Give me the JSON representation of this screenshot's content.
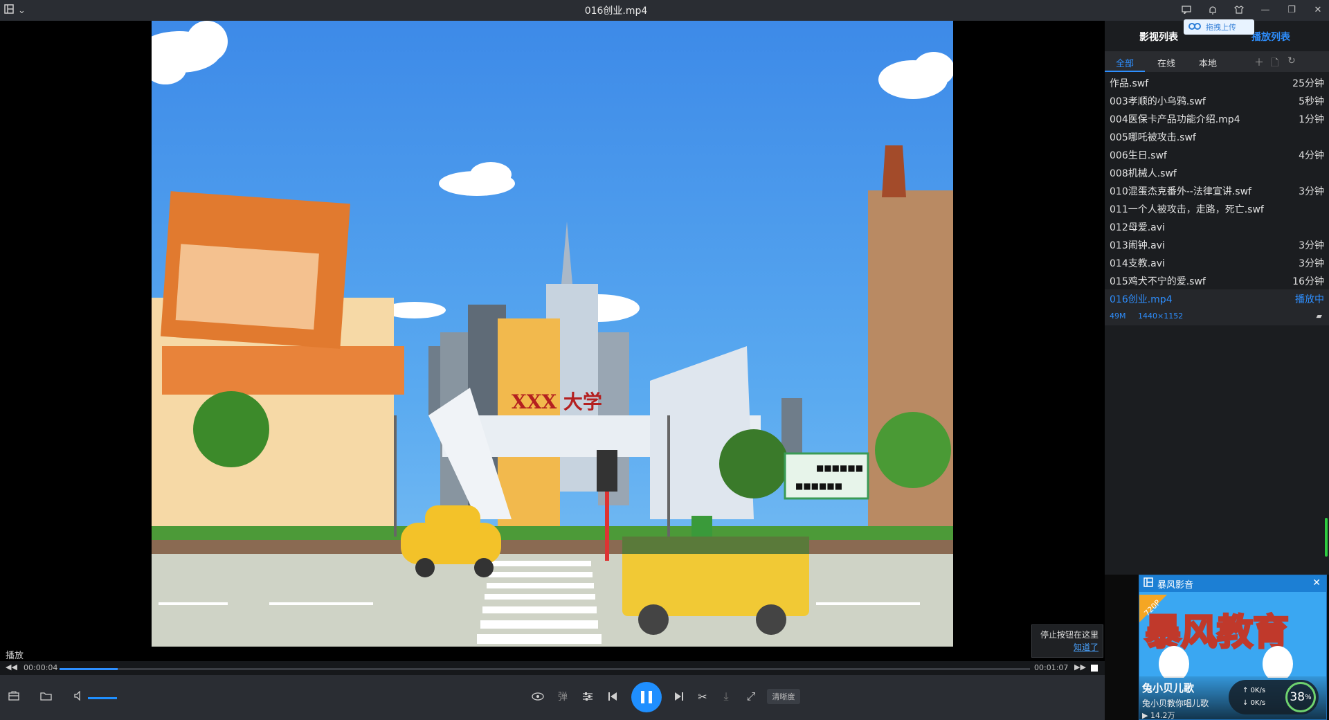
{
  "window": {
    "title": "016创业.mp4",
    "upload_tip": "拖拽上传"
  },
  "scene": {
    "gate_sign": "XXX 大学",
    "arrow_sign_top": "■■■■■■",
    "arrow_sign_bottom": "■■■■■■"
  },
  "player": {
    "status": "播放",
    "current_time": "00:00:04",
    "total_time": "00:01:07",
    "progress_fraction": 0.06,
    "volume_fraction": 0.7,
    "quality_label": "清晰度",
    "danmaku_label": "弹",
    "stop_tip": {
      "text": "停止按钮在这里",
      "ok": "知道了"
    }
  },
  "sidebar": {
    "tabs": [
      "影视列表",
      "播放列表"
    ],
    "filters": [
      "全部",
      "在线",
      "本地"
    ],
    "items": [
      {
        "name": "作品.swf",
        "duration": "25分钟"
      },
      {
        "name": "003孝顺的小乌鸦.swf",
        "duration": "5秒钟"
      },
      {
        "name": "004医保卡产品功能介绍.mp4",
        "duration": "1分钟"
      },
      {
        "name": "005哪吒被攻击.swf",
        "duration": ""
      },
      {
        "name": "006生日.swf",
        "duration": "4分钟"
      },
      {
        "name": "008机械人.swf",
        "duration": ""
      },
      {
        "name": "010混蛋杰克番外--法律宣讲.swf",
        "duration": "3分钟"
      },
      {
        "name": "011一个人被攻击，走路，死亡.swf",
        "duration": ""
      },
      {
        "name": "012母爱.avi",
        "duration": ""
      },
      {
        "name": "013闹钟.avi",
        "duration": "3分钟"
      },
      {
        "name": "014支教.avi",
        "duration": "3分钟"
      },
      {
        "name": "015鸡犬不宁的爱.swf",
        "duration": "16分钟"
      },
      {
        "name": "016创业.mp4",
        "duration": "播放中"
      }
    ],
    "current_meta": {
      "size": "49M",
      "resolution": "1440×1152"
    }
  },
  "ad": {
    "brand": "暴风影音",
    "badge": "720P",
    "headline": "暴风教育",
    "title": "兔小贝儿歌",
    "subtitle": "兔小贝教你唱儿歌",
    "views": "14.2万",
    "upload_speed": "0K/s",
    "download_speed": "0K/s",
    "percent": "38",
    "percent_sign": "%"
  },
  "colors": {
    "accent": "#1f8fff",
    "titlebar": "#2a2d33",
    "sidebar_bg": "#1b1d20"
  }
}
